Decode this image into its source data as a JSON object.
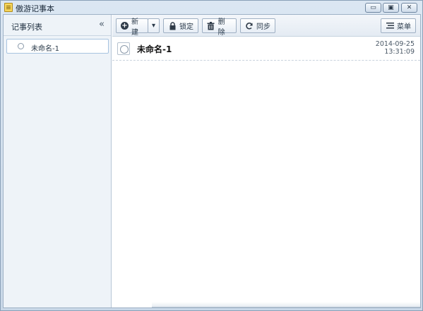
{
  "window": {
    "title": "傲游记事本",
    "min_label": "▭",
    "max_label": "▣",
    "close_label": "✕"
  },
  "sidebar": {
    "title": "记事列表",
    "collapse_label": "«",
    "items": [
      {
        "label": "未命名-1"
      }
    ]
  },
  "toolbar": {
    "new_label": "新建",
    "new_dropdown_label": "▾",
    "lock_label": "锁定",
    "delete_label": "删除",
    "sync_label": "同步",
    "menu_label": "菜单"
  },
  "notes": [
    {
      "title": "未命名-1",
      "date": "2014-09-25",
      "time": "13:31:09"
    }
  ]
}
